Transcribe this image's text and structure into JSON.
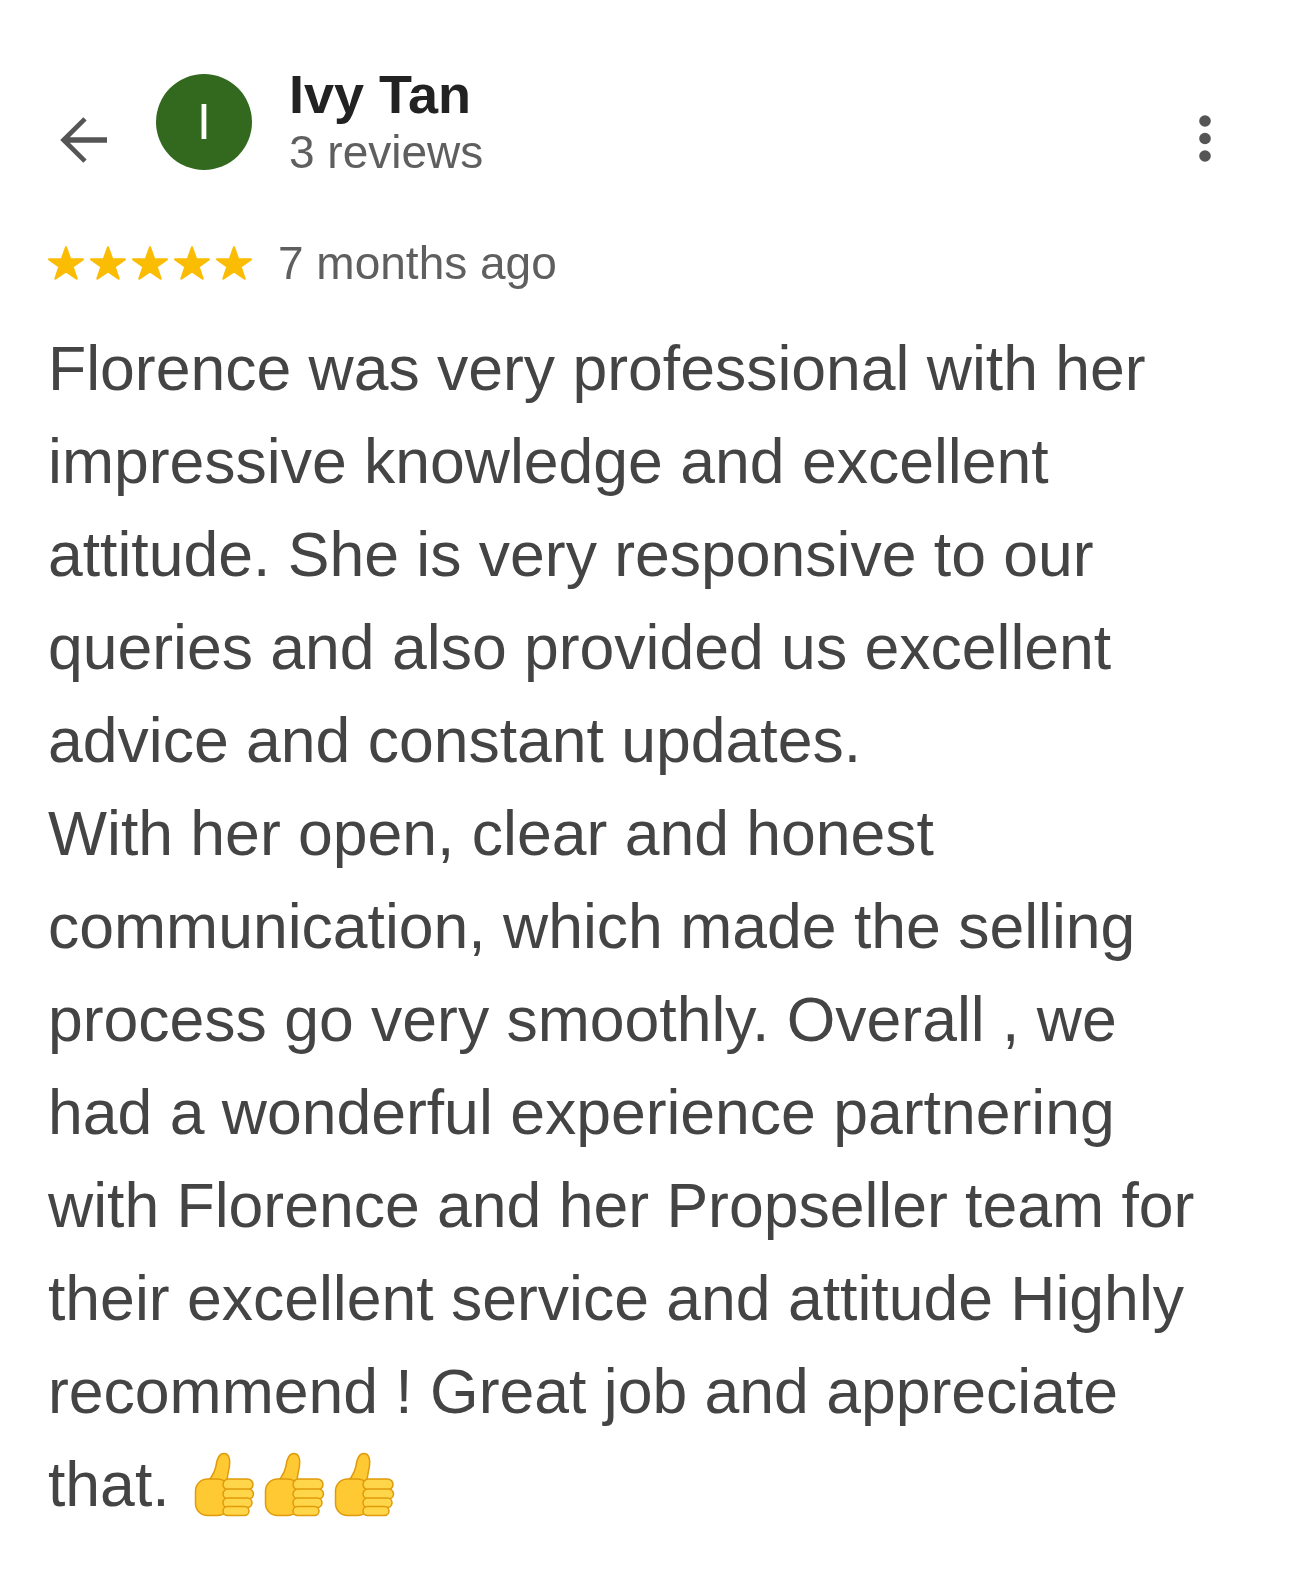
{
  "header": {
    "avatar_initial": "I",
    "name": "Ivy Tan",
    "review_count": "3 reviews"
  },
  "review": {
    "stars": 5,
    "time": "7 months ago",
    "paragraphs": [
      "Florence was very professional with her impressive knowledge and excellent attitude. She is very responsive to our queries and also provided us excellent advice and constant updates.",
      "With her open, clear and honest communication, which made the selling process go very smoothly. Overall , we had a wonderful experience partnering with Florence and her Propseller team for their excellent service and attitude Highly recommend ! Great job and appreciate that."
    ],
    "emojis": [
      {
        "kind": "thumbs_up"
      },
      {
        "kind": "thumbs_up"
      },
      {
        "kind": "thumbs_up"
      }
    ]
  }
}
